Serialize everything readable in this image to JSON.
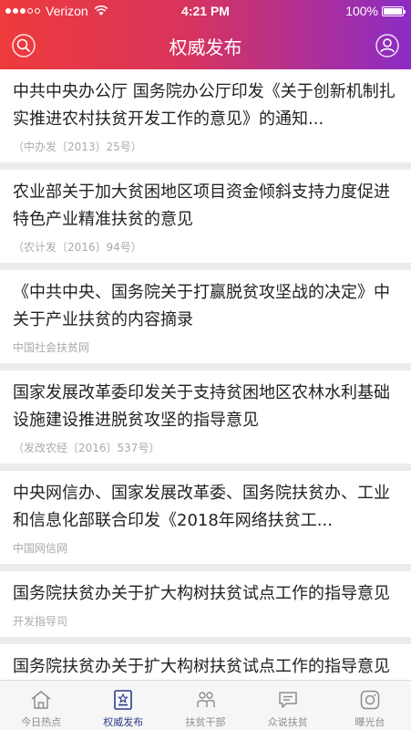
{
  "status_bar": {
    "carrier": "Verizon",
    "time": "4:21 PM",
    "battery": "100%"
  },
  "header": {
    "title": "权威发布",
    "left_icon": "search-icon",
    "right_icon": "user-icon"
  },
  "articles": [
    {
      "title": "中共中央办公厅  国务院办公厅印发《关于创新机制扎实推进农村扶贫开发工作的意见》的通知...",
      "source": "（中办发〔2013〕25号）"
    },
    {
      "title": "农业部关于加大贫困地区项目资金倾斜支持力度促进特色产业精准扶贫的意见",
      "source": "（农计发〔2016〕94号）"
    },
    {
      "title": "《中共中央、国务院关于打赢脱贫攻坚战的决定》中关于产业扶贫的内容摘录",
      "source": "中国社会扶贫网"
    },
    {
      "title": "国家发展改革委印发关于支持贫困地区农林水利基础设施建设推进脱贫攻坚的指导意见",
      "source": "（发改农经〔2016〕537号）"
    },
    {
      "title": "中央网信办、国家发展改革委、国务院扶贫办、工业和信息化部联合印发《2018年网络扶贫工...",
      "source": "中国网信网"
    },
    {
      "title": "国务院扶贫办关于扩大构树扶贫试点工作的指导意见",
      "source": "开发指导司"
    },
    {
      "title": "国务院扶贫办关于扩大构树扶贫试点工作的指导意见",
      "source": ""
    }
  ],
  "tabs": [
    {
      "label": "今日热点",
      "icon": "home-icon",
      "active": false
    },
    {
      "label": "权威发布",
      "icon": "announcement-icon",
      "active": true
    },
    {
      "label": "扶贫干部",
      "icon": "people-icon",
      "active": false
    },
    {
      "label": "众说扶贫",
      "icon": "chat-icon",
      "active": false
    },
    {
      "label": "曝光台",
      "icon": "camera-icon",
      "active": false
    }
  ],
  "colors": {
    "header_start": "#ee3b3b",
    "header_end": "#8b2cc4",
    "tab_active": "#2b3a8c",
    "tab_inactive": "#8d8d8d"
  }
}
